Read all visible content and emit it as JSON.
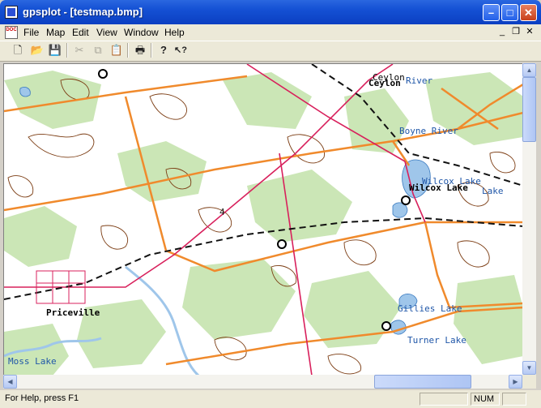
{
  "window": {
    "title": "gpsplot - [testmap.bmp]",
    "minimize_glyph": "–",
    "maximize_glyph": "□",
    "close_glyph": "✕"
  },
  "menu": {
    "items": [
      "File",
      "Map",
      "Edit",
      "View",
      "Window",
      "Help"
    ],
    "doc_icon_text": "DOC",
    "mdi_minimize": "_",
    "mdi_restore": "❐",
    "mdi_close": "✕"
  },
  "toolbar": {
    "tools": [
      {
        "name": "new",
        "glyph": "🗋"
      },
      {
        "name": "open",
        "glyph": "📂"
      },
      {
        "name": "save",
        "glyph": "💾"
      },
      {
        "name": "cut",
        "glyph": "✂"
      },
      {
        "name": "copy",
        "glyph": "⧉"
      },
      {
        "name": "paste",
        "glyph": "📋"
      },
      {
        "name": "print",
        "glyph": "🖶"
      },
      {
        "name": "about",
        "glyph": "?"
      },
      {
        "name": "context-help",
        "glyph": "↖?"
      }
    ]
  },
  "map": {
    "labels": {
      "ceylon": "Ceylon",
      "ceylon_overlay": "Ceylon",
      "beaver_river": "River",
      "boyne_river": "Boyne River",
      "wilcox_lake": "Wilcox Lake",
      "wilcox_lake_overlay": "Wilcox Lake",
      "wilcox_lake_sub": "Lake",
      "priceville": "Priceville",
      "gillies_lake": "Gillies Lake",
      "turner_lake": "Turner Lake",
      "moss_lake": "Moss Lake",
      "road_number": "4"
    },
    "colors": {
      "land": "#ffffff",
      "forest": "#cbe6b6",
      "water": "#9fc6ea",
      "contour": "#7a3a10",
      "highway": "#f08a2c",
      "boundary": "#d8205c",
      "railway": "#111111",
      "label_blue": "#1f56a8",
      "label_black": "#000000"
    }
  },
  "status": {
    "help_text": "For Help, press F1",
    "num_indicator": "NUM"
  }
}
